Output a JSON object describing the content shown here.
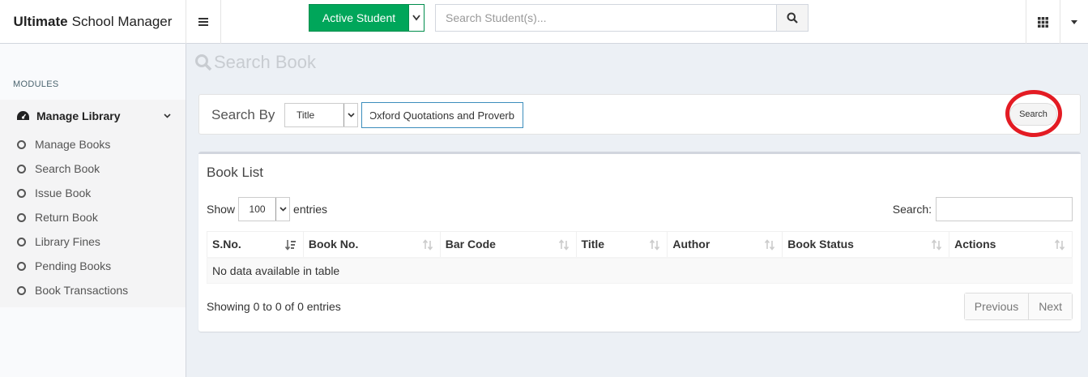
{
  "brand": {
    "bold": "Ultimate",
    "rest": "School Manager"
  },
  "header": {
    "active_student_label": "Active Student",
    "search_placeholder": "Search Student(s)..."
  },
  "sidebar": {
    "modules_header": "MODULES",
    "group_label": "Manage Library",
    "items": [
      {
        "label": "Manage Books"
      },
      {
        "label": "Search Book"
      },
      {
        "label": "Issue Book"
      },
      {
        "label": "Return Book"
      },
      {
        "label": "Library Fines"
      },
      {
        "label": "Pending Books"
      },
      {
        "label": "Book Transactions"
      }
    ]
  },
  "page": {
    "title": "Search Book"
  },
  "search_form": {
    "label": "Search By",
    "select_value": "Title",
    "input_value": "Oxford Quotations and Proverb",
    "button_label": "Search"
  },
  "book_list": {
    "title": "Book List",
    "show_label": "Show",
    "entries_value": "100",
    "entries_label": "entries",
    "search_label": "Search:",
    "columns": [
      "S.No.",
      "Book No.",
      "Bar Code",
      "Title",
      "Author",
      "Book Status",
      "Actions"
    ],
    "empty_message": "No data available in table",
    "info": "Showing 0 to 0 of 0 entries",
    "prev_label": "Previous",
    "next_label": "Next"
  },
  "colors": {
    "accent_green": "#00a65a",
    "highlight_red": "#e31b23",
    "input_focus": "#3c8dbc"
  }
}
